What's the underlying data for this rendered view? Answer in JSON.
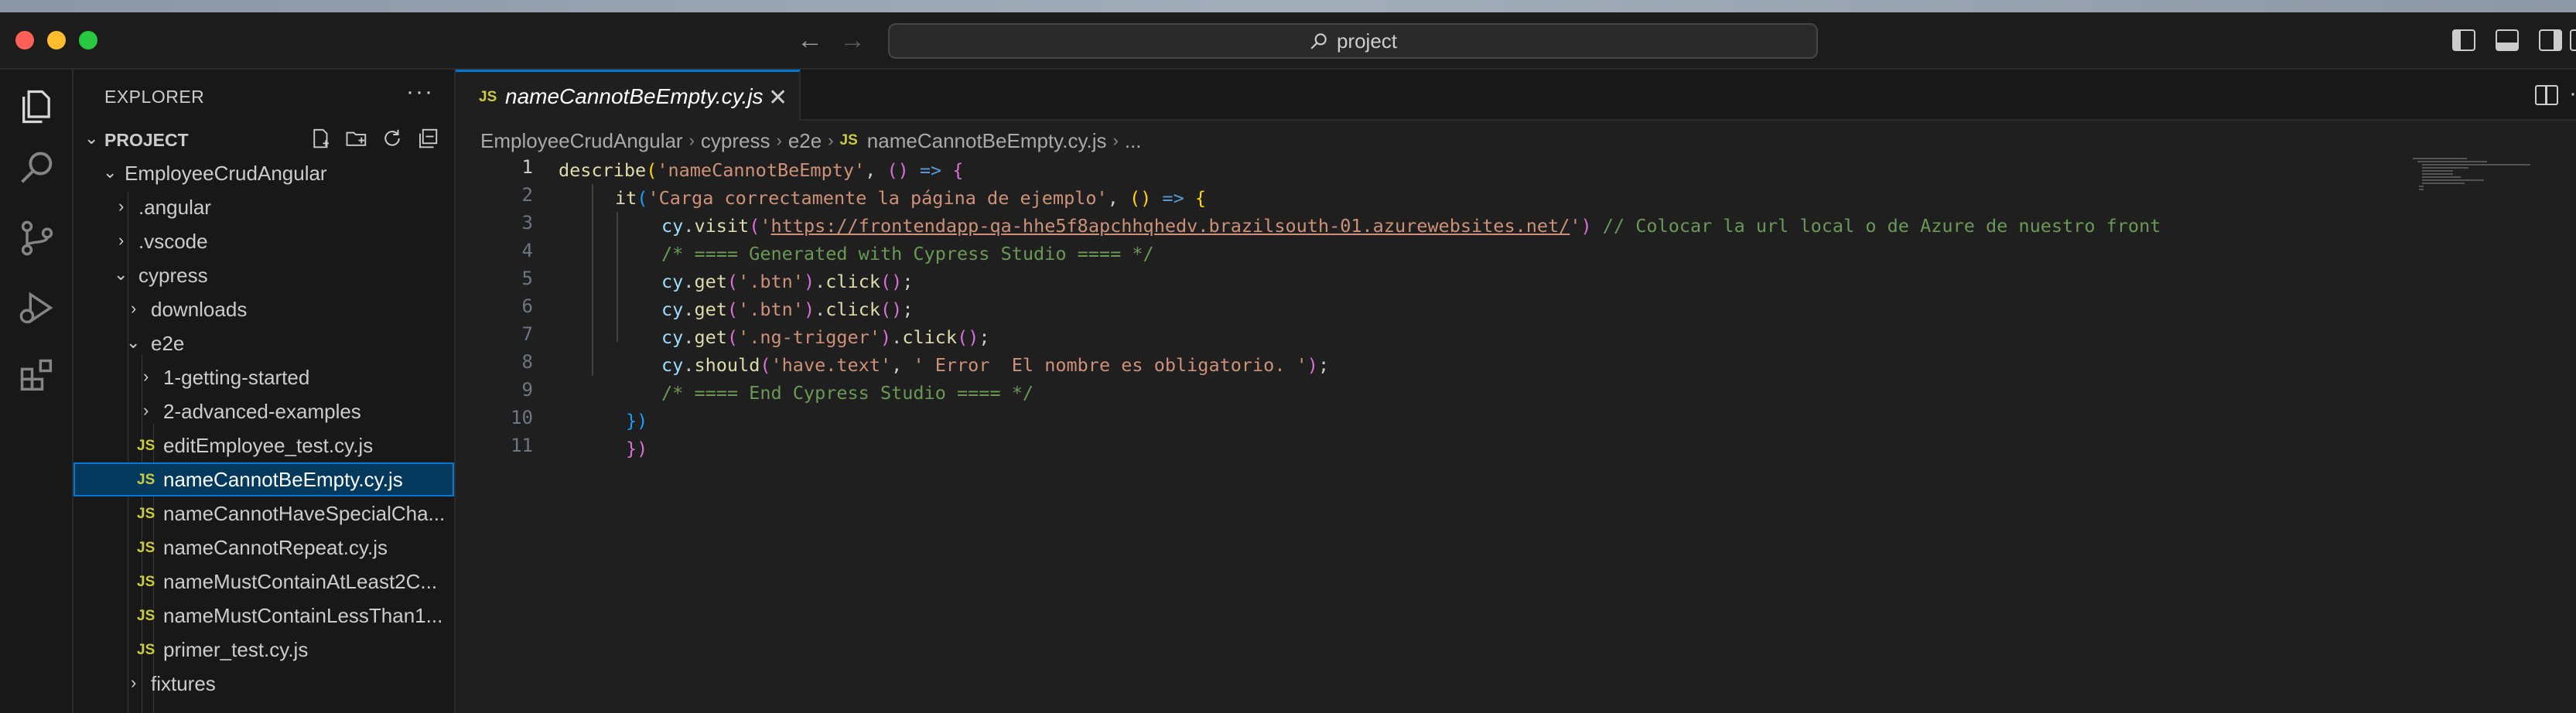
{
  "titlebar": {
    "search_text": "project"
  },
  "sidebar": {
    "title": "EXPLORER",
    "more": "···",
    "section_label": "PROJECT",
    "tree": [
      {
        "label": "EmployeeCrudAngular",
        "kind": "folder-open"
      },
      {
        "label": ".angular",
        "kind": "folder-closed"
      },
      {
        "label": ".vscode",
        "kind": "folder-closed"
      },
      {
        "label": "cypress",
        "kind": "folder-open"
      },
      {
        "label": "downloads",
        "kind": "folder-closed"
      },
      {
        "label": "e2e",
        "kind": "folder-open"
      },
      {
        "label": "1-getting-started",
        "kind": "folder-closed"
      },
      {
        "label": "2-advanced-examples",
        "kind": "folder-closed"
      },
      {
        "label": "editEmployee_test.cy.js",
        "kind": "file"
      },
      {
        "label": "nameCannotBeEmpty.cy.js",
        "kind": "file",
        "selected": true
      },
      {
        "label": "nameCannotHaveSpecialCha...",
        "kind": "file"
      },
      {
        "label": "nameCannotRepeat.cy.js",
        "kind": "file"
      },
      {
        "label": "nameMustContainAtLeast2C...",
        "kind": "file"
      },
      {
        "label": "nameMustContainLessThan1...",
        "kind": "file"
      },
      {
        "label": "primer_test.cy.js",
        "kind": "file"
      },
      {
        "label": "fixtures",
        "kind": "folder-closed"
      }
    ],
    "file_badge": "JS"
  },
  "editor": {
    "tab_label": "nameCannotBeEmpty.cy.js",
    "tab_badge": "JS",
    "breadcrumb": [
      "EmployeeCrudAngular",
      "cypress",
      "e2e",
      "nameCannotBeEmpty.cy.js",
      "..."
    ],
    "line_numbers": [
      "1",
      "2",
      "3",
      "4",
      "5",
      "6",
      "7",
      "8",
      "9",
      "10",
      "11"
    ],
    "code": {
      "l1": {
        "fn": "describe",
        "p1": "(",
        "str": "'nameCannotBeEmpty'",
        "comma": ", ",
        "p2": "()",
        "arrow": " => ",
        "brace": "{"
      },
      "l2": {
        "fn": "it",
        "p1": "(",
        "str": "'Carga correctamente la página de ejemplo'",
        "comma": ", ",
        "p2": "()",
        "arrow": " => ",
        "brace": "{"
      },
      "l3": {
        "obj": "cy",
        "dot": ".",
        "fn": "visit",
        "p1": "(",
        "q1": "'",
        "url": "https://frontendapp-qa-hhe5f8apchhqhedv.brazilsouth-01.azurewebsites.net/",
        "q2": "'",
        "p2": ")",
        "comment": " // Colocar la url local o de Azure de nuestro front"
      },
      "l4": {
        "comment": "/* ==== Generated with Cypress Studio ==== */"
      },
      "l5": {
        "obj": "cy",
        "fn1": "get",
        "arg": "'.btn'",
        "fn2": "click"
      },
      "l6": {
        "obj": "cy",
        "fn1": "get",
        "arg": "'.btn'",
        "fn2": "click"
      },
      "l7": {
        "obj": "cy",
        "fn1": "get",
        "arg": "'.ng-trigger'",
        "fn2": "click"
      },
      "l8": {
        "obj": "cy",
        "fn": "should",
        "arg1": "'have.text'",
        "arg2": "' Error  El nombre es obligatorio. '"
      },
      "l9": {
        "comment": "/* ==== End Cypress Studio ==== */"
      },
      "l10": {
        "close": "})"
      },
      "l11": {
        "close": "})"
      }
    }
  },
  "colors": {
    "accent": "#0078d4",
    "selection": "#04395e",
    "js_badge": "#cbcb41"
  }
}
